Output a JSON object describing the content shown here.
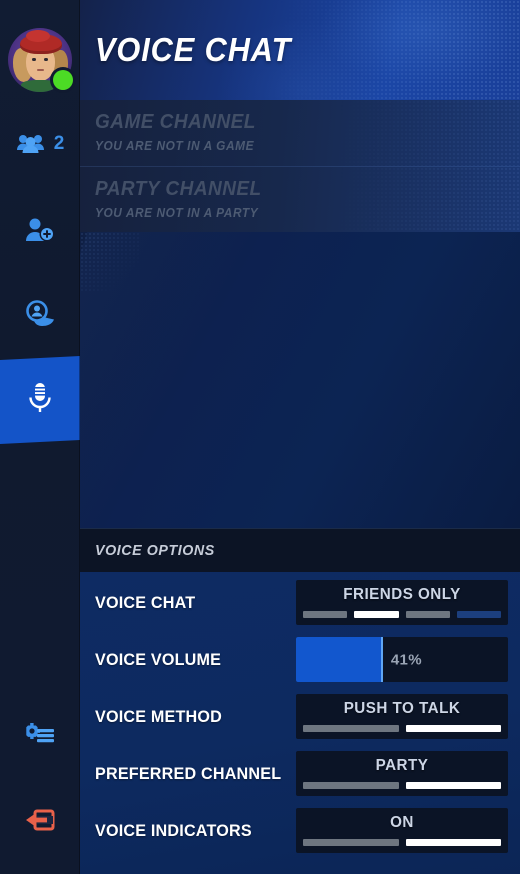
{
  "rail": {
    "avatar": {
      "name": "user-avatar",
      "status": "online",
      "status_color": "#4cdb25"
    },
    "items": [
      {
        "icon": "friends-group-icon",
        "label": "2",
        "name": "sidebar-item-friends",
        "active": false
      },
      {
        "icon": "add-friend-icon",
        "label": "",
        "name": "sidebar-item-add-friend",
        "active": false
      },
      {
        "icon": "recent-players-icon",
        "label": "",
        "name": "sidebar-item-recent-players",
        "active": false
      },
      {
        "icon": "microphone-icon",
        "label": "",
        "name": "sidebar-item-voice-chat",
        "active": true
      },
      {
        "icon": "settings-gear-list-icon",
        "label": "",
        "name": "sidebar-item-settings",
        "active": false
      },
      {
        "icon": "exit-arrow-icon",
        "label": "",
        "name": "sidebar-item-exit",
        "active": false
      }
    ],
    "friend_count": "2",
    "accent_color": "#1454c8",
    "exit_color": "#e8614a"
  },
  "header": {
    "title": "VOICE CHAT"
  },
  "channels": [
    {
      "title": "GAME CHANNEL",
      "subtitle": "YOU ARE NOT IN A GAME"
    },
    {
      "title": "PARTY CHANNEL",
      "subtitle": "YOU ARE NOT IN A PARTY"
    }
  ],
  "options": {
    "section_title": "VOICE OPTIONS",
    "rows": [
      {
        "label": "VOICE CHAT",
        "type": "segmented",
        "value": "FRIENDS ONLY",
        "segments": 4,
        "active_index": 1
      },
      {
        "label": "VOICE VOLUME",
        "type": "slider",
        "value": "41%",
        "percent": 41
      },
      {
        "label": "VOICE METHOD",
        "type": "segmented",
        "value": "PUSH TO TALK",
        "segments": 2,
        "active_index": 1
      },
      {
        "label": "PREFERRED CHANNEL",
        "type": "segmented",
        "value": "PARTY",
        "segments": 2,
        "active_index": 1
      },
      {
        "label": "VOICE INDICATORS",
        "type": "segmented",
        "value": "ON",
        "segments": 2,
        "active_index": 1
      }
    ]
  }
}
